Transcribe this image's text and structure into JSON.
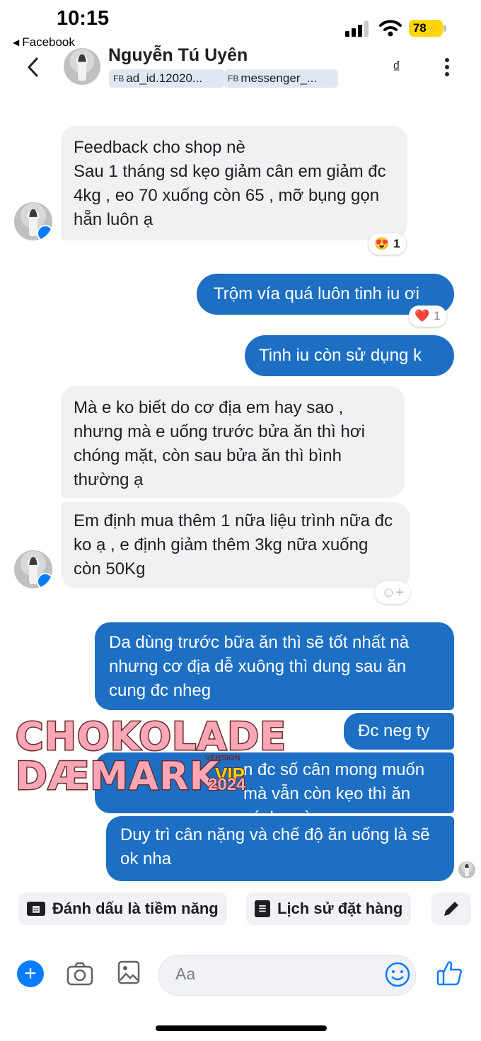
{
  "status_bar": {
    "time": "10:15",
    "back_app": "Facebook",
    "battery": "78"
  },
  "header": {
    "contact_name": "Nguyễn Tú Uyên",
    "tags": [
      {
        "prefix": "FB",
        "label": "ad_id.12020..."
      },
      {
        "prefix": "FB",
        "label": "messenger_..."
      }
    ],
    "currency_icon": "₫"
  },
  "messages": [
    {
      "dir": "in",
      "text": "Feedback cho shop nè\nSau 1 tháng sd kẹo giảm cân em giảm đc 4kg , eo 70 xuống còn 65 , mỡ bụng gọn hẵn luôn ạ",
      "reaction": {
        "emoji": "😍",
        "count": "1"
      }
    },
    {
      "dir": "out",
      "text": "Trộm vía quá luôn tinh iu ơi",
      "reaction": {
        "emoji": "❤️",
        "count": "1"
      }
    },
    {
      "dir": "out",
      "text": "Tinh iu còn sử dụng k"
    },
    {
      "dir": "in",
      "text": "Mà e ko biết do cơ địa em hay sao , nhưng mà e uống trước bửa ăn thì hơi chóng mặt, còn sau bửa ăn thì bình thường ạ"
    },
    {
      "dir": "in",
      "text": "Em định mua thêm 1 nữa liệu trình nữa đc ko ạ , e định giảm thêm 3kg nữa xuống còn 50Kg"
    },
    {
      "dir": "out",
      "text": "Da dùng trước bữa ăn thì sẽ tốt nhất nà nhưng cơ địa dễ xuông thì dung sau ăn cung đc nheg"
    },
    {
      "dir": "out",
      "text": "Đc neg ty"
    },
    {
      "dir": "out",
      "text": "n đc số cân mong muốn mà vẫn còn kẹo thì ăn cách ngày"
    },
    {
      "dir": "out",
      "text": "Duy trì cân nặng và chế độ ăn uống là sẽ ok nha"
    }
  ],
  "watermark": {
    "line1": "CHOKOLADE",
    "line2": "DÆMARK",
    "version": "VERSION",
    "vip": "VIP",
    "year": "2024"
  },
  "actions": {
    "mark_lead": "Đánh dấu là tiềm năng",
    "order_history": "Lịch sử đặt hàng"
  },
  "composer": {
    "placeholder": "Aa"
  },
  "colors": {
    "outgoing": "#1d6fc4",
    "incoming": "#f0f1f3",
    "accent": "#0a7cff"
  }
}
